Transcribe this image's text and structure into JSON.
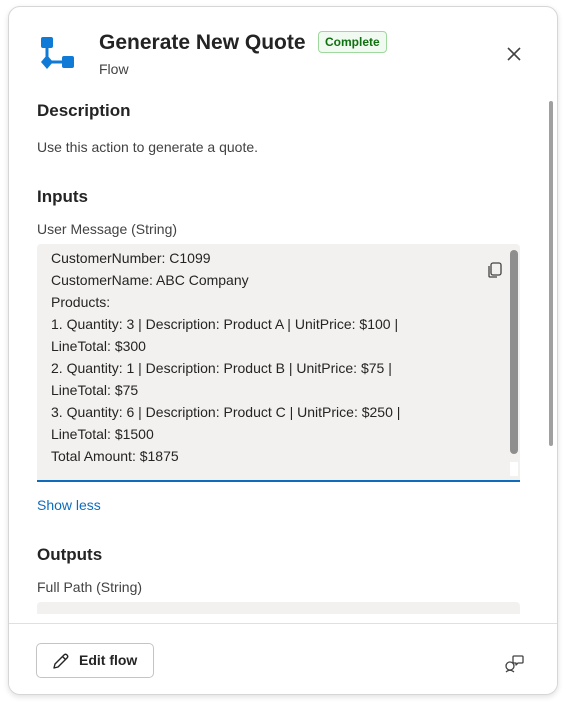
{
  "header": {
    "title": "Generate New Quote",
    "status_badge": "Complete",
    "subtitle": "Flow",
    "flow_icon": "flow-diagram-icon",
    "close_icon": "close-icon"
  },
  "description": {
    "heading": "Description",
    "text": "Use this action to generate a quote."
  },
  "inputs": {
    "heading": "Inputs",
    "field_label": "User Message (String)",
    "lines": [
      "CustomerNumber: C1099",
      "CustomerName: ABC Company",
      "Products:",
      "1. Quantity: 3 | Description: Product A | UnitPrice: $100 |",
      "LineTotal: $300",
      "2. Quantity: 1 | Description: Product B | UnitPrice: $75 |",
      "LineTotal: $75",
      "3. Quantity: 6 | Description: Product C | UnitPrice: $250 |",
      "LineTotal: $1500",
      "Total Amount: $1875"
    ],
    "copy_icon": "copy-icon",
    "toggle_label": "Show less"
  },
  "outputs": {
    "heading": "Outputs",
    "field_label": "Full Path (String)"
  },
  "footer": {
    "edit_label": "Edit flow",
    "edit_icon": "pencil-icon",
    "feedback_icon": "feedback-icon"
  },
  "colors": {
    "accent": "#0f6cbd",
    "badge_text": "#0e700e",
    "badge_bg": "#f1faf1",
    "icon_blue": "#0f7bd6",
    "field_bg": "#f3f1ef"
  }
}
